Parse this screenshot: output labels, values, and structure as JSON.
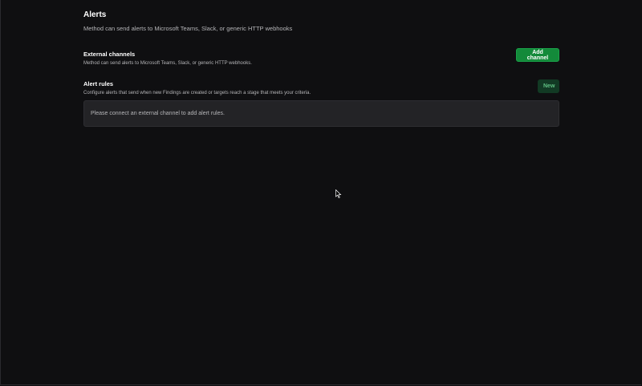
{
  "page": {
    "title": "Alerts",
    "subtitle": "Method can send alerts to Microsoft Teams, Slack, or generic HTTP webhooks"
  },
  "external_channels": {
    "title": "External channels",
    "description": "Method can send alerts to Microsoft Teams, Slack, or generic HTTP webhooks.",
    "button_label": "Add channel"
  },
  "alert_rules": {
    "title": "Alert rules",
    "description": "Configure alerts that send when new Findings are created or targets reach a stage that meets your criteria.",
    "button_label": "New",
    "empty_message": "Please connect an external channel to add alert rules."
  },
  "colors": {
    "background": "#0f0f11",
    "primary_button": "#138a3a",
    "secondary_button": "#123a24",
    "panel": "#232326"
  },
  "icons": {
    "cursor": "mouse-pointer-icon"
  }
}
